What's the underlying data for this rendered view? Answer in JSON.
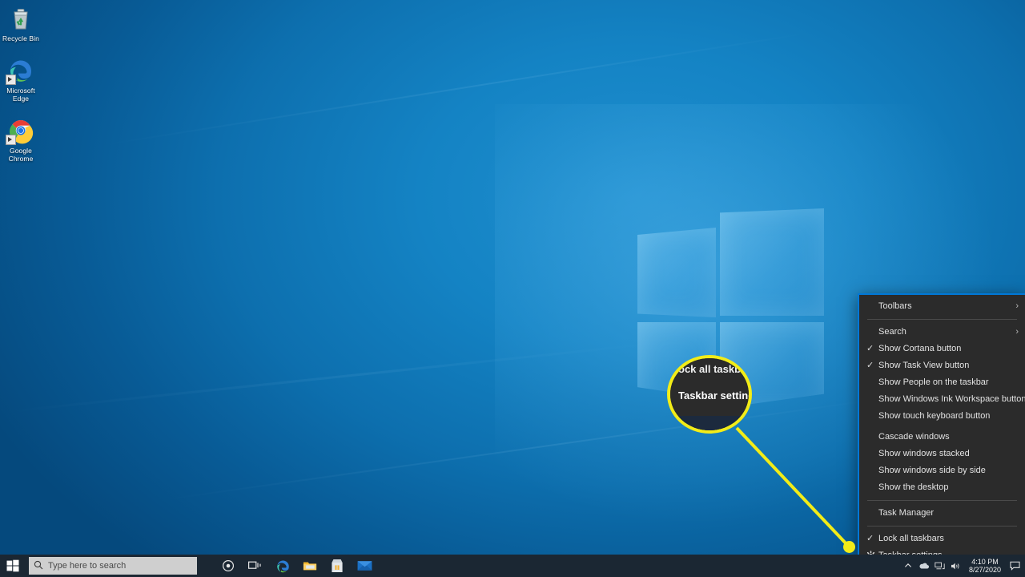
{
  "desktop": {
    "icons": [
      {
        "name": "recycle-bin",
        "label": "Recycle Bin"
      },
      {
        "name": "microsoft-edge",
        "label": "Microsoft Edge"
      },
      {
        "name": "google-chrome",
        "label": "Google Chrome"
      }
    ]
  },
  "context_menu": {
    "items": [
      {
        "label": "Toolbars",
        "checked": false,
        "submenu": true,
        "icon": ""
      },
      {
        "label": "Search",
        "checked": false,
        "submenu": true,
        "icon": ""
      },
      {
        "label": "Show Cortana button",
        "checked": true,
        "submenu": false,
        "icon": ""
      },
      {
        "label": "Show Task View button",
        "checked": true,
        "submenu": false,
        "icon": ""
      },
      {
        "label": "Show People on the taskbar",
        "checked": false,
        "submenu": false,
        "icon": ""
      },
      {
        "label": "Show Windows Ink Workspace button",
        "checked": false,
        "submenu": false,
        "icon": ""
      },
      {
        "label": "Show touch keyboard button",
        "checked": false,
        "submenu": false,
        "icon": ""
      },
      {
        "label": "Cascade windows",
        "checked": false,
        "submenu": false,
        "icon": ""
      },
      {
        "label": "Show windows stacked",
        "checked": false,
        "submenu": false,
        "icon": ""
      },
      {
        "label": "Show windows side by side",
        "checked": false,
        "submenu": false,
        "icon": ""
      },
      {
        "label": "Show the desktop",
        "checked": false,
        "submenu": false,
        "icon": ""
      },
      {
        "label": "Task Manager",
        "checked": false,
        "submenu": false,
        "icon": ""
      },
      {
        "label": "Lock all taskbars",
        "checked": true,
        "submenu": false,
        "icon": ""
      },
      {
        "label": "Taskbar settings",
        "checked": false,
        "submenu": false,
        "icon": "gear-icon"
      }
    ],
    "checkmark_glyph": "✓",
    "chevron_glyph": "›",
    "accent_color": "#0078d7",
    "background_color": "#2b2b2b"
  },
  "callout": {
    "magnified_top_text": "ock all taskbar",
    "magnified_main_text": "Taskbar settings",
    "highlight_color": "#f2ec18"
  },
  "taskbar": {
    "start_label": "Start",
    "search": {
      "placeholder": "Type here to search",
      "value": "",
      "icon": "search-icon"
    },
    "apps": [
      {
        "name": "cortana",
        "label": "Cortana"
      },
      {
        "name": "task-view",
        "label": "Task View"
      },
      {
        "name": "microsoft-edge",
        "label": "Microsoft Edge"
      },
      {
        "name": "file-explorer",
        "label": "File Explorer"
      },
      {
        "name": "microsoft-store",
        "label": "Microsoft Store"
      },
      {
        "name": "mail",
        "label": "Mail"
      }
    ],
    "tray": [
      {
        "name": "show-hidden-icons",
        "glyph": "⌃"
      },
      {
        "name": "onedrive-icon",
        "glyph": "☁"
      },
      {
        "name": "network-icon",
        "glyph": "Ὓ3"
      },
      {
        "name": "volume-icon",
        "glyph": "ὐA"
      }
    ],
    "clock": {
      "time": "4:10 PM",
      "date": "8/27/2020"
    },
    "action_center_label": "Action Center"
  }
}
